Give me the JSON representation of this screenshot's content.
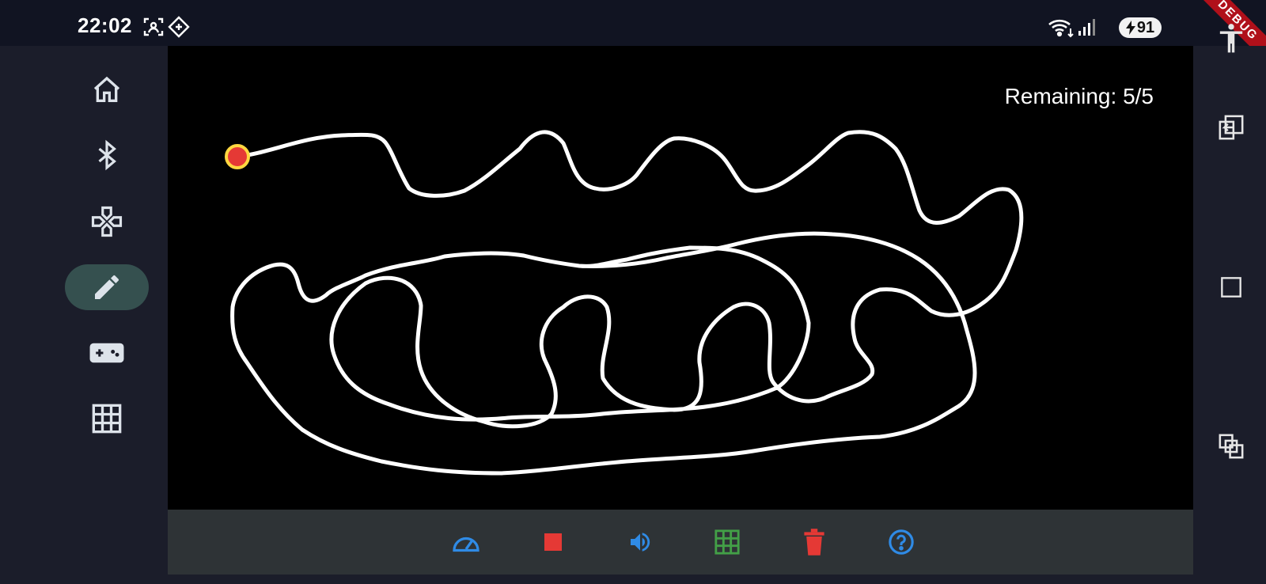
{
  "status": {
    "time": "22:02",
    "battery_level": "91",
    "debug_label": "DEBUG"
  },
  "sidebar": {
    "items": [
      {
        "icon": "home-icon"
      },
      {
        "icon": "bluetooth-icon"
      },
      {
        "icon": "dpad-icon"
      },
      {
        "icon": "pencil-icon",
        "active": true
      },
      {
        "icon": "gamepad-icon"
      },
      {
        "icon": "grid-icon"
      }
    ]
  },
  "canvas": {
    "remaining": "Remaining: 5/5",
    "start_marker_color": "#e53935",
    "path_color": "#ffffff"
  },
  "toolbar": {
    "items": [
      {
        "icon": "speedometer-icon",
        "color": "#2f8be6"
      },
      {
        "icon": "stop-icon",
        "color": "#e53935"
      },
      {
        "icon": "volume-icon",
        "color": "#2f8be6"
      },
      {
        "icon": "grid-icon",
        "color": "#43a047"
      },
      {
        "icon": "trash-icon",
        "color": "#e53935"
      },
      {
        "icon": "help-icon",
        "color": "#2f8be6"
      }
    ]
  },
  "right_rail": {
    "items": [
      {
        "icon": "rotate-screen-icon"
      },
      {
        "icon": "square-icon"
      },
      {
        "icon": "split-screen-icon"
      }
    ]
  }
}
